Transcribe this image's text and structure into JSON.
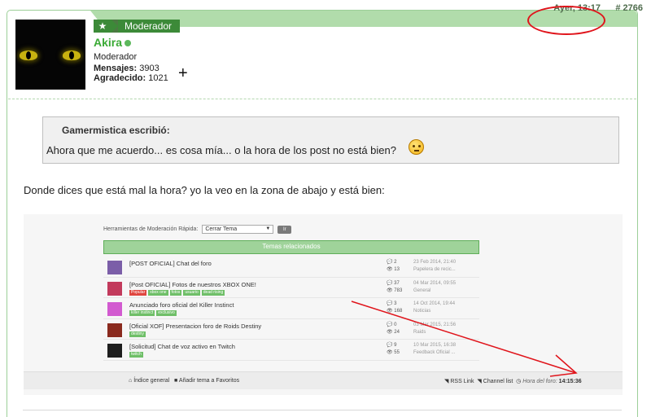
{
  "post": {
    "time": "Ayer, 13:17",
    "number": "# 2766"
  },
  "user": {
    "rank": "Moderador",
    "name": "Akira",
    "role": "Moderador",
    "posts_label": "Mensajes:",
    "posts": "3903",
    "thanks_label": "Agradecido:",
    "thanks": "1021",
    "plus": "+"
  },
  "quote": {
    "author": "Gamermistica escribió:",
    "text": "Ahora que me acuerdo... es cosa mía... o la hora de los post no está bien?"
  },
  "reply": "Donde dices que está mal la hora? yo la veo en la zona de abajo y está bien:",
  "embed": {
    "mod_label": "Herramientas de Moderación Rápida:",
    "mod_select": "Cerrar Tema",
    "mod_go": "Ir",
    "related_title": "Temas relacionados",
    "topics": [
      {
        "title": "[POST OFICIAL] Chat del foro",
        "tags": [],
        "replies": "2",
        "views": "13",
        "date": "23 Feb 2014, 21:40",
        "forum": "Papelera de recic..."
      },
      {
        "title": "[Post OFICIAL] Fotos de nuestros XBOX ONE!",
        "tags": [
          "Popular",
          "xbox one",
          "fotos",
          "usuario",
          "dead rising"
        ],
        "replies": "37",
        "views": "783",
        "date": "04 Mar 2014, 09:55",
        "forum": "General"
      },
      {
        "title": "Anunciado foro oficial del Killer Instinct",
        "tags": [
          "killer instinct",
          "exclusivo"
        ],
        "replies": "3",
        "views": "168",
        "date": "14 Oct 2014, 19:44",
        "forum": "Noticias"
      },
      {
        "title": "[Oficial XOF] Presentacion foro de Roids Destiny",
        "tags": [
          "destiny"
        ],
        "replies": "0",
        "views": "24",
        "date": "03 Mar 2015, 21:56",
        "forum": "Raids"
      },
      {
        "title": "[Solicitud] Chat de voz activo en Twitch",
        "tags": [
          "twitch"
        ],
        "replies": "9",
        "views": "55",
        "date": "10 Mar 2015, 16:38",
        "forum": "Feedback Oficial ..."
      }
    ],
    "footer": {
      "index": "Índice general",
      "favorites": "Añadir tema a Favoritos",
      "rss": "RSS Link",
      "channels": "Channel list",
      "foro_label": "Hora del foro:",
      "foro_time": "14:15:36"
    }
  },
  "colors": {
    "accent_green": "#3aaa35",
    "header_green": "#b1dcab",
    "annotation_red": "#e0141b"
  }
}
